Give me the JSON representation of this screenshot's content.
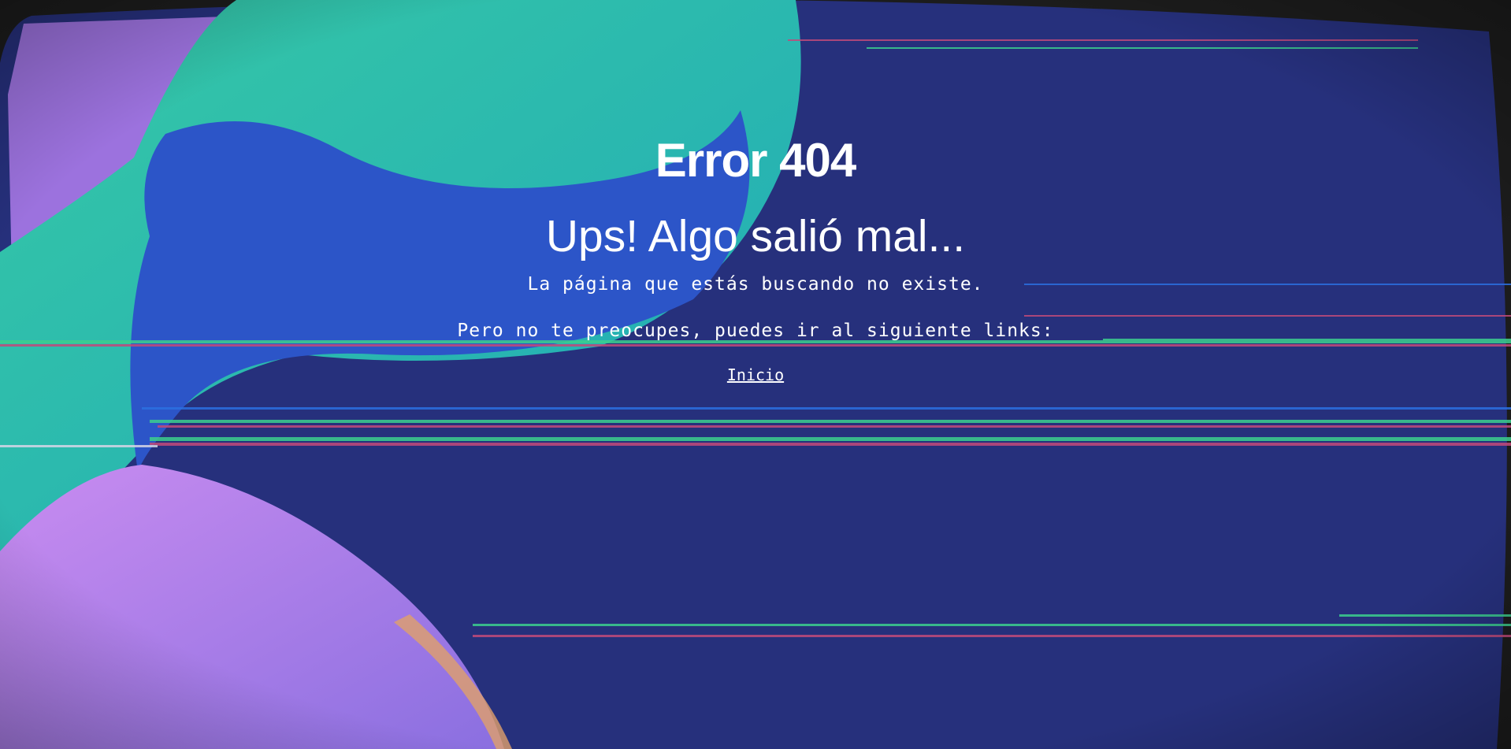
{
  "page": {
    "title": "Error 404",
    "subtitle": "Ups! Algo salió mal...",
    "message": "La página que estás buscando no existe.",
    "hint": "Pero no te preocupes, puedes ir al siguiente links:",
    "link_label": "Inicio"
  },
  "colors": {
    "background_navy": "#26307c",
    "teal": "#2fbca4",
    "blue": "#2c55c8",
    "violet": "#b37ee6",
    "text": "#ffffff"
  }
}
